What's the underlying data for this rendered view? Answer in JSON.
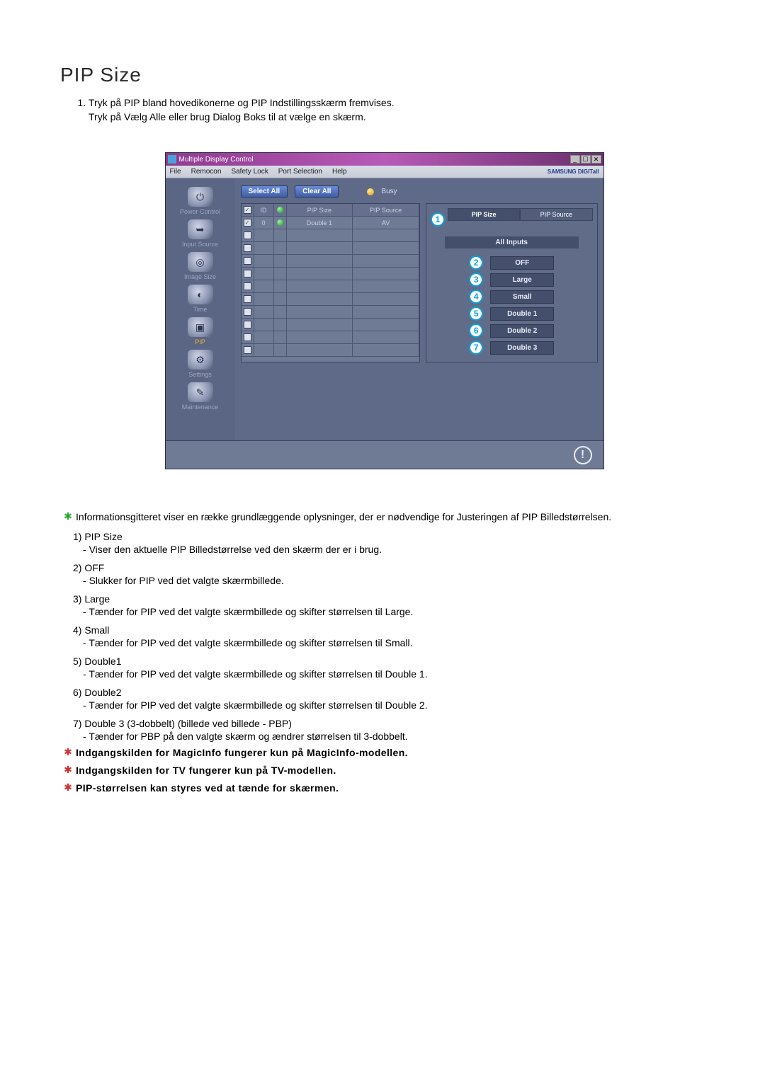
{
  "heading": "PIP Size",
  "intro": [
    "Tryk på PIP bland hovedikonerne og PIP Indstillingsskærm fremvises.",
    "Tryk på Vælg Alle eller brug Dialog Boks til at vælge en skærm."
  ],
  "window": {
    "title": "Multiple Display Control",
    "controls": {
      "min": "_",
      "max": "☐",
      "close": "✕"
    },
    "menus": [
      "File",
      "Remocon",
      "Safety Lock",
      "Port Selection",
      "Help"
    ],
    "brand": "SAMSUNG DIGITall",
    "sidebar": [
      {
        "label": "Power Control",
        "glyph": "⏻"
      },
      {
        "label": "Input Source",
        "glyph": "➥"
      },
      {
        "label": "Image Size",
        "glyph": "◎"
      },
      {
        "label": "Time",
        "glyph": "◐"
      },
      {
        "label": "PIP",
        "glyph": "▣",
        "active": true
      },
      {
        "label": "Settings",
        "glyph": "⚙"
      },
      {
        "label": "Maintenance",
        "glyph": "✎"
      }
    ],
    "toolbar": {
      "selectAll": "Select All",
      "clearAll": "Clear All",
      "busy": "Busy"
    },
    "table": {
      "headers": [
        "",
        "ID",
        "",
        "PIP Size",
        "PIP Source"
      ],
      "rows": [
        {
          "checked": true,
          "id": "0",
          "status": "ok",
          "size": "Double 1",
          "source": "AV"
        },
        {
          "checked": false
        },
        {
          "checked": false
        },
        {
          "checked": false
        },
        {
          "checked": false
        },
        {
          "checked": false
        },
        {
          "checked": false
        },
        {
          "checked": false
        },
        {
          "checked": false
        },
        {
          "checked": false
        },
        {
          "checked": false
        }
      ]
    },
    "panel": {
      "tabs": {
        "size": "PIP Size",
        "source": "PIP Source"
      },
      "allInputs": "All Inputs",
      "options": [
        {
          "n": "2",
          "label": "OFF"
        },
        {
          "n": "3",
          "label": "Large"
        },
        {
          "n": "4",
          "label": "Small"
        },
        {
          "n": "5",
          "label": "Double 1"
        },
        {
          "n": "6",
          "label": "Double 2"
        },
        {
          "n": "7",
          "label": "Double 3"
        }
      ],
      "calloutTab": "1"
    }
  },
  "descIntro": "Informationsgitteret viser en række grundlæggende oplysninger, der er nødvendige for Justeringen af PIP Billedstørrelsen.",
  "items": [
    {
      "n": "1)",
      "title": "PIP Size",
      "body": "Viser den aktuelle PIP Billedstørrelse ved den skærm der er i brug."
    },
    {
      "n": "2)",
      "title": "OFF",
      "body": "Slukker for PIP ved det valgte skærmbillede."
    },
    {
      "n": "3)",
      "title": "Large",
      "body": "Tænder for PIP ved det valgte skærmbillede og skifter størrelsen til Large."
    },
    {
      "n": "4)",
      "title": "Small",
      "body": "Tænder for PIP ved det valgte skærmbillede og skifter størrelsen til Small."
    },
    {
      "n": "5)",
      "title": "Double1",
      "body": "Tænder for PIP ved det valgte skærmbillede og skifter størrelsen til Double 1."
    },
    {
      "n": "6)",
      "title": "Double2",
      "body": "Tænder for PIP ved det valgte skærmbillede og skifter størrelsen til Double 2."
    },
    {
      "n": "7)",
      "title": "Double 3 (3-dobbelt) (billede ved billede - PBP)",
      "body": "Tænder for PBP på den valgte skærm og ændrer størrelsen til 3-dobbelt."
    }
  ],
  "notes": [
    "Indgangskilden for MagicInfo fungerer kun på MagicInfo-modellen.",
    "Indgangskilden for TV fungerer kun på TV-modellen.",
    "PIP-størrelsen kan styres ved at tænde for skærmen."
  ]
}
